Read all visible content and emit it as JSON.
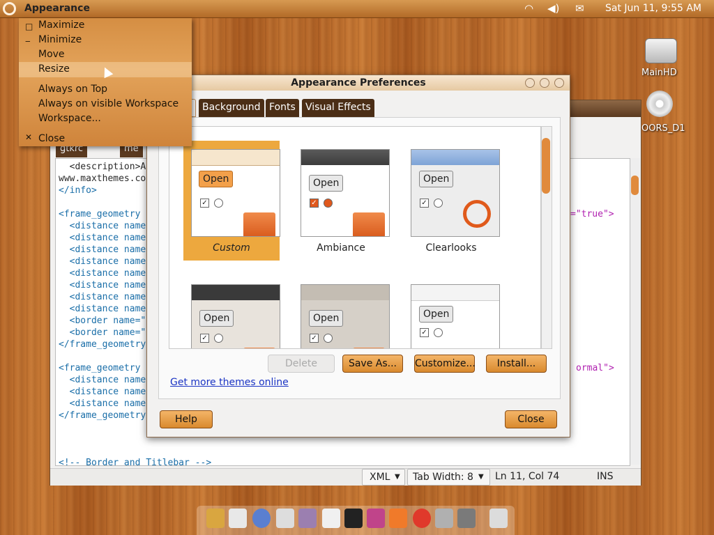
{
  "top_panel": {
    "app_name": "Appearance",
    "clock": "Sat Jun 11,  9:55 AM",
    "tray_icons": [
      "network-icon",
      "volume-icon",
      "mail-icon"
    ]
  },
  "window_menu": {
    "items": [
      {
        "label": "Maximize",
        "icon": "maximize-icon"
      },
      {
        "label": "Minimize",
        "icon": "minimize-icon"
      },
      {
        "label": "Move"
      },
      {
        "label": "Resize"
      },
      {
        "label": "Always on Top"
      },
      {
        "label": "Always on visible Workspace"
      },
      {
        "label": "Workspace..."
      },
      {
        "label": "Close",
        "icon": "close-icon"
      }
    ]
  },
  "desktop": {
    "icons": [
      {
        "label": "MainHD",
        "icon": "harddrive-icon"
      },
      {
        "label": "OORS_D1",
        "icon": "dvd-icon"
      }
    ]
  },
  "editor": {
    "tabs": [
      "gtkrc",
      "me"
    ],
    "code_lines": [
      "  <description>A",
      "www.maxthemes.co",
      "</info>",
      "",
      "<frame_geometry",
      "  <distance name",
      "  <distance name",
      "  <distance name",
      "  <distance name",
      "  <distance name",
      "  <distance name",
      "  <distance name",
      "  <distance name",
      "  <border name=\"",
      "  <border name=\"",
      "</frame_geometry",
      "",
      "<frame_geometry",
      "  <distance name",
      "  <distance name",
      "  <distance name",
      "</frame_geometry",
      "",
      "",
      "<!-- Border and Titlebar -->"
    ],
    "right_fragment_1": "=\"true\">",
    "right_fragment_2": "ormal\">",
    "status": {
      "language": "XML",
      "tab_width": "Tab Width:  8",
      "position": "Ln 11, Col 74",
      "mode": "INS"
    }
  },
  "dialog": {
    "title": "Appearance Preferences",
    "tabs": [
      "Background",
      "Fonts",
      "Visual Effects"
    ],
    "themes": [
      {
        "name": "Custom",
        "selected": true,
        "button": "Open"
      },
      {
        "name": "Ambiance",
        "selected": false,
        "button": "Open"
      },
      {
        "name": "Clearlooks",
        "selected": false,
        "button": "Open"
      },
      {
        "name": "",
        "selected": false,
        "button": "Open"
      },
      {
        "name": "",
        "selected": false,
        "button": "Open"
      },
      {
        "name": "",
        "selected": false,
        "button": "Open"
      }
    ],
    "buttons": {
      "delete": "Delete",
      "save_as": "Save As...",
      "customize": "Customize...",
      "install": "Install...",
      "help": "Help",
      "close": "Close"
    },
    "more_themes_link": "Get more themes online"
  },
  "colors": {
    "accent_orange": "#e08a3c",
    "selected_theme_bg": "#eda83e",
    "panel_brown": "#b26a27"
  }
}
